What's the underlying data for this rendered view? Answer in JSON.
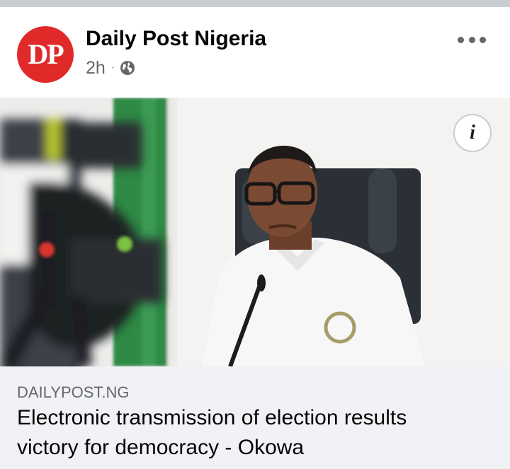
{
  "post": {
    "author": "Daily Post Nigeria",
    "avatar_initials": "DP",
    "time_ago": "2h",
    "separator": "·",
    "privacy_icon": "globe-icon",
    "more_icon": "more-options-icon"
  },
  "image": {
    "info_label": "i"
  },
  "link": {
    "domain": "DAILYPOST.NG",
    "title": "Electronic transmission of election results victory for democracy - Okowa"
  },
  "colors": {
    "brand_red": "#e02a2a",
    "secondary_text": "#65676b",
    "preview_background": "#f0f2f5"
  }
}
